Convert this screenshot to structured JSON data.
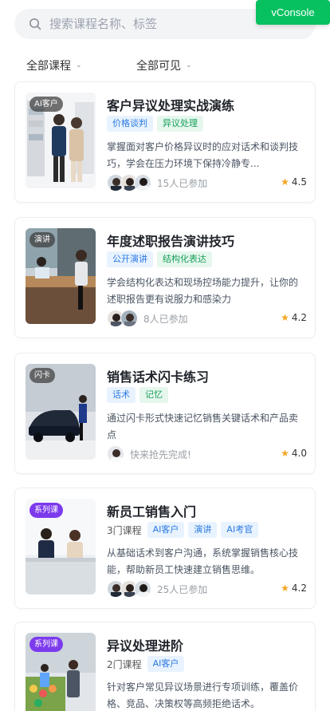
{
  "search": {
    "placeholder": "搜索课程名称、标签"
  },
  "vconsole": {
    "label": "vConsole"
  },
  "filters": {
    "category": "全部课程",
    "visibility": "全部可见"
  },
  "colors": {
    "tag_blue": "#2b79e0",
    "tag_green": "#18a058",
    "star": "#f5a623",
    "series_badge": "#7c3aed",
    "vconsole": "#07c160"
  },
  "courses": [
    {
      "badge": "AI客户",
      "title": "客户异议处理实战演练",
      "tags": [
        "价格谈判",
        "异议处理"
      ],
      "desc": "掌握面对客户价格异议时的应对话术和谈判技巧，学会在压力环境下保持冷静专...",
      "joined": "15人已参加",
      "rating": "4.5"
    },
    {
      "badge": "演讲",
      "title": "年度述职报告演讲技巧",
      "tags": [
        "公开演讲",
        "结构化表达"
      ],
      "desc": "学会结构化表达和现场控场能力提升，让你的述职报告更有说服力和感染力",
      "joined": "8人已参加",
      "rating": "4.2"
    },
    {
      "badge": "闪卡",
      "title": "销售话术闪卡练习",
      "tags": [
        "话术",
        "记忆"
      ],
      "desc": "通过闪卡形式快速记忆销售关键话术和产品卖点",
      "joined": "快来抢先完成!",
      "rating": "4.0"
    },
    {
      "badge": "系列课",
      "title": "新员工销售入门",
      "count": "3门课程",
      "tags": [
        "AI客户",
        "演讲",
        "AI考官"
      ],
      "desc": "从基础话术到客户沟通，系统掌握销售核心技能，帮助新员工快速建立销售思维。",
      "joined": "25人已参加",
      "rating": "4.2"
    },
    {
      "badge": "系列课",
      "title": "异议处理进阶",
      "count": "2门课程",
      "tags": [
        "AI客户"
      ],
      "desc": "针对客户常见异议场景进行专项训练，覆盖价格、竞品、决策权等高频拒绝话术。"
    }
  ]
}
